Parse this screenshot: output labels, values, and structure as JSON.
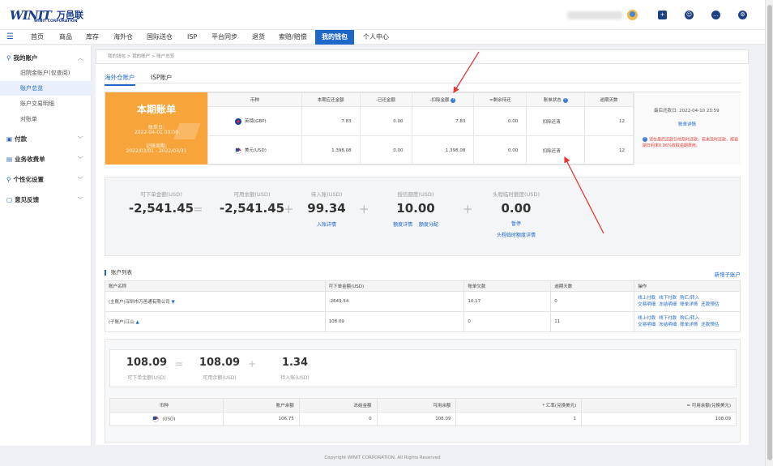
{
  "brand": {
    "mark": "WINIT",
    "cn": "万邑联",
    "sub": "WINIT CORPORATION"
  },
  "nav": {
    "items": [
      "首页",
      "商品",
      "库存",
      "海外仓",
      "国际送仓",
      "ISP",
      "平台同步",
      "退货",
      "索赔/赔偿",
      "我的钱包",
      "个人中心"
    ],
    "active_index": 9
  },
  "sidebar": {
    "group_account": "我的账户",
    "items": [
      "旧院金账户(仅查阅)",
      "账户总览",
      "账户交易明细",
      "对账单"
    ],
    "active_item": 1,
    "group_pay": "付款",
    "group_fee": "业务收费单",
    "group_custom": "个性化设置",
    "group_feedback": "意见反馈"
  },
  "breadcrumb": "我的钱包 > 我的账户 > 账户总览",
  "tabs": [
    "海外仓账户",
    "ISP账户"
  ],
  "bill": {
    "title": "本期账单",
    "date_label": "账单日:",
    "date_value": "2022-04-01 00:00",
    "period_label": "记账周期:",
    "period_value": "2022/03/01 - 2022/03/31",
    "headers": [
      "币种",
      "本期应还金额",
      "-已还金额",
      "-扣除金额",
      "=剩余待还",
      "账单状态",
      "逾期天数"
    ],
    "rows": [
      {
        "currency": "英镑(GBP)",
        "due": "7.83",
        "paid": "0.00",
        "deducted": "7.83",
        "remaining": "0.00",
        "status": "扣除还清",
        "overdue": "12"
      },
      {
        "currency": "美元(USD)",
        "due": "1,398.08",
        "paid": "0.00",
        "deducted": "1,398.08",
        "remaining": "0.00",
        "status": "扣除还清",
        "overdue": "12"
      }
    ],
    "side_last": "最后还款日: 2022-04-10 23:59",
    "side_link": "账单详情",
    "side_note": "请在最后还款日前及时还款，若未及时还款，按逾期日利率0.06%收取逾期费用。"
  },
  "summary": {
    "items": [
      {
        "label": "可下单金额(USD)",
        "value": "-2,541.45"
      },
      {
        "label": "可用余额(USD)",
        "value": "-2,541.45"
      },
      {
        "label": "待入账(USD)",
        "value": "99.34",
        "link": "入账详情"
      },
      {
        "label": "授信额度(USD)",
        "value": "10.00",
        "link": "额度详情",
        "link2": "额度分配"
      },
      {
        "label": "头程临时额度(USD)",
        "value": "0.00",
        "status": "暂停",
        "link": "头程临时额度详情"
      }
    ],
    "ops": [
      "=",
      "+",
      "+",
      "+"
    ]
  },
  "accounts": {
    "title": "账户列表",
    "add_link": "新增子账户",
    "headers": [
      "账户名称",
      "可下单金额(USD)",
      "账单欠款",
      "逾期天数",
      "操作"
    ],
    "rows": [
      {
        "name": "(主账户)深圳市万邑通有限公司",
        "amount": "-2649.54",
        "debt": "10.17",
        "overdue": "0",
        "ops1": [
          "线上付款",
          "线下付款",
          "购汇/转入"
        ],
        "ops2": [
          "交易明细",
          "冻结明细",
          "账单详情",
          "还款预估"
        ]
      },
      {
        "name": "(子账户)江山",
        "amount": "108.09",
        "debt": "0",
        "overdue": "11",
        "ops1": [
          "线上付款",
          "线下付款",
          "购汇/转入"
        ],
        "ops2": [
          "交易明细",
          "冻结明细",
          "账单详情",
          "还款预估"
        ]
      }
    ]
  },
  "sub": {
    "items": [
      {
        "value": "108.09",
        "label": "可下单金额(USD)"
      },
      {
        "value": "108.09",
        "label": "可用余额(USD)"
      },
      {
        "value": "1.34",
        "label": "待入账(USD)"
      }
    ],
    "ops": [
      "=",
      "+"
    ],
    "headers": [
      "币种",
      "账户余额",
      "冻结金额",
      "可用余额",
      "* 汇率(兑换美元)",
      "= 可用余额(兑换美元)"
    ],
    "row": {
      "currency": "(USD)",
      "balance": "106.75",
      "frozen": "0",
      "available": "108.09",
      "rate": "1",
      "available_usd": "108.09"
    }
  },
  "footer": "Copyright WINIT CORPORATION. All Rights Reserved"
}
